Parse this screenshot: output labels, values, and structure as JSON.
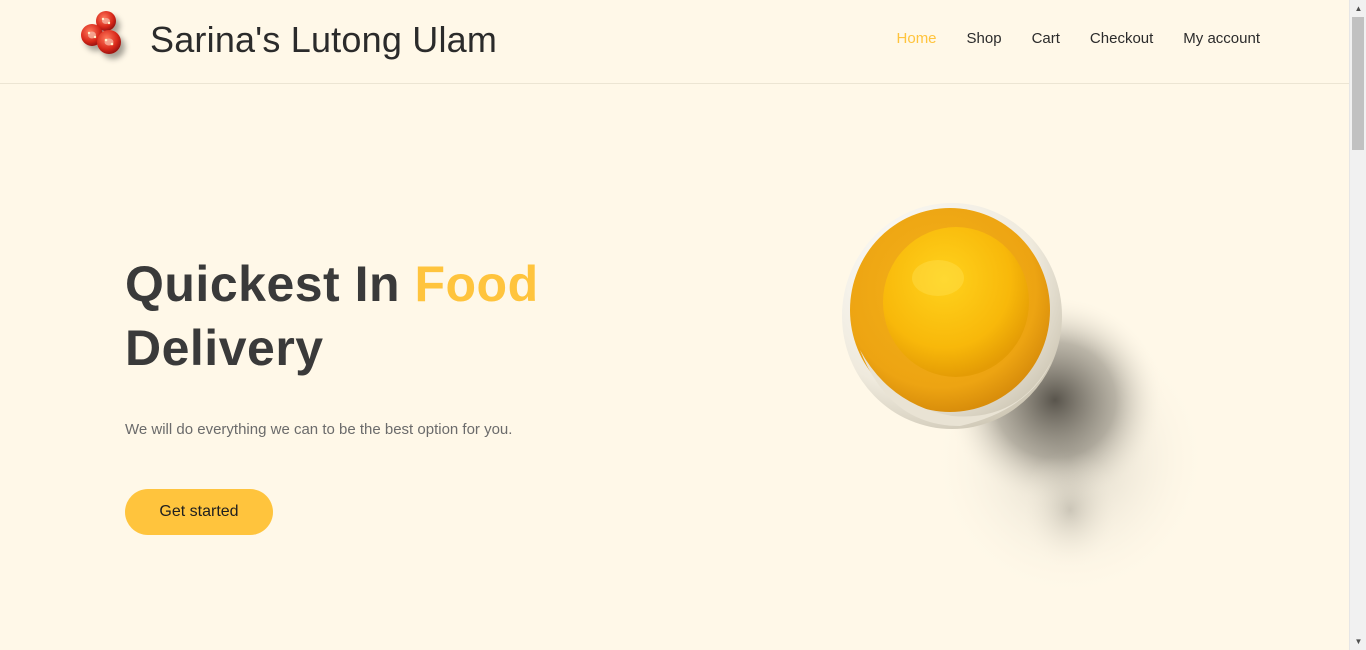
{
  "site": {
    "title": "Sarina's Lutong Ulam",
    "logo_icon": "tomato-logo-icon"
  },
  "nav": {
    "items": [
      {
        "label": "Home",
        "active": true
      },
      {
        "label": "Shop",
        "active": false
      },
      {
        "label": "Cart",
        "active": false
      },
      {
        "label": "Checkout",
        "active": false
      },
      {
        "label": "My account",
        "active": false
      }
    ]
  },
  "hero": {
    "title_part1": "Quickest In ",
    "title_accent": "Food",
    "title_part2": "Delivery",
    "subtitle": "We will do everything we can to be the best option for you.",
    "cta_label": "Get started",
    "image_icon": "egg-yolk-image"
  },
  "colors": {
    "background": "#fff8e8",
    "accent": "#ffc43d",
    "text": "#2b2b2b"
  }
}
